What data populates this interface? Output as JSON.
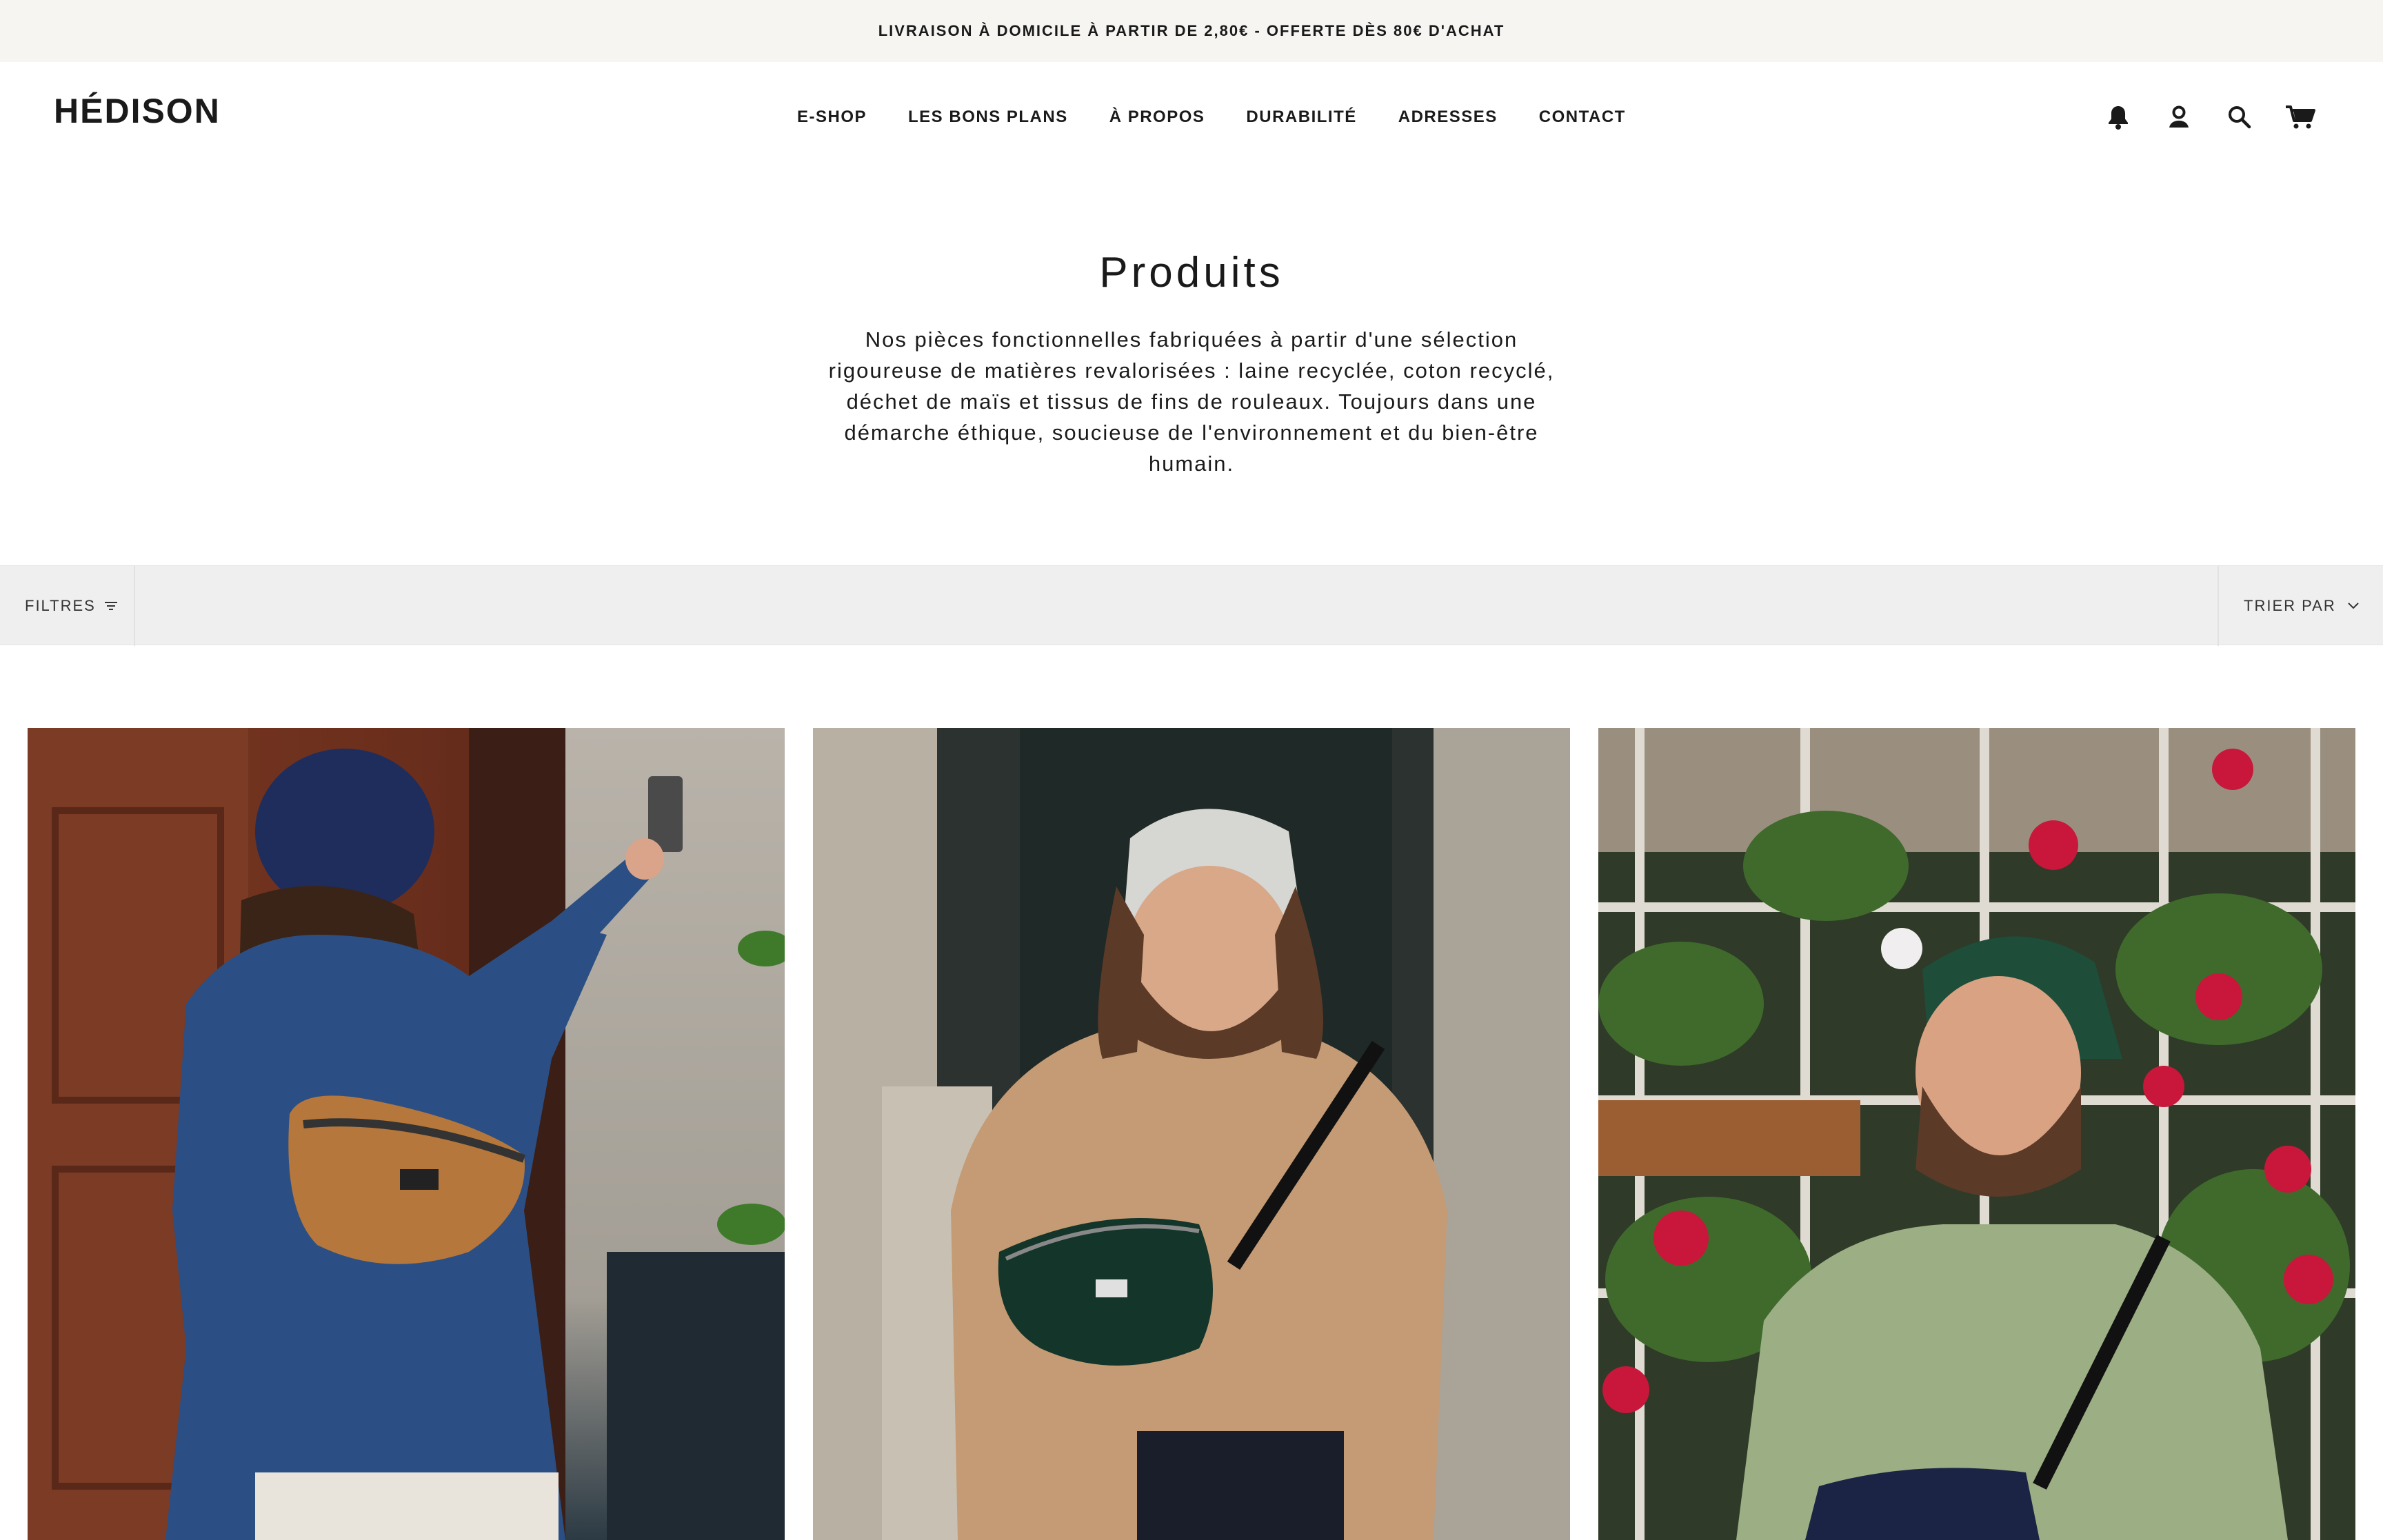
{
  "announcement": "LIVRAISON À DOMICILE À PARTIR DE 2,80€ - OFFERTE DÈS 80€ D'ACHAT",
  "header": {
    "logo": "HÉDISON",
    "nav": [
      "E-SHOP",
      "LES BONS PLANS",
      "À PROPOS",
      "DURABILITÉ",
      "ADRESSES",
      "CONTACT"
    ],
    "icons": [
      "bell-icon",
      "account-icon",
      "search-icon",
      "cart-icon"
    ]
  },
  "collection": {
    "title": "Produits",
    "description": "Nos pièces fonctionnelles fabriquées à partir d'une sélection rigoureuse de matières revalorisées : laine recyclée, coton recyclé, déchet de maïs et tissus de fins de rouleaux. Toujours dans une démarche éthique, soucieuse de l'environnement et du bien-être humain."
  },
  "toolbar": {
    "filters_label": "FILTRES",
    "sort_label": "TRIER PAR"
  },
  "products": [
    {
      "image": "woman-blue-beanie-tan-bag"
    },
    {
      "image": "man-grey-beanie-green-bag"
    },
    {
      "image": "man-green-cap-navy-bag"
    }
  ],
  "colors": {
    "announcement_bg": "#f6f5f2",
    "filterbar_bg": "#efefef",
    "text": "#1a1a1a"
  }
}
